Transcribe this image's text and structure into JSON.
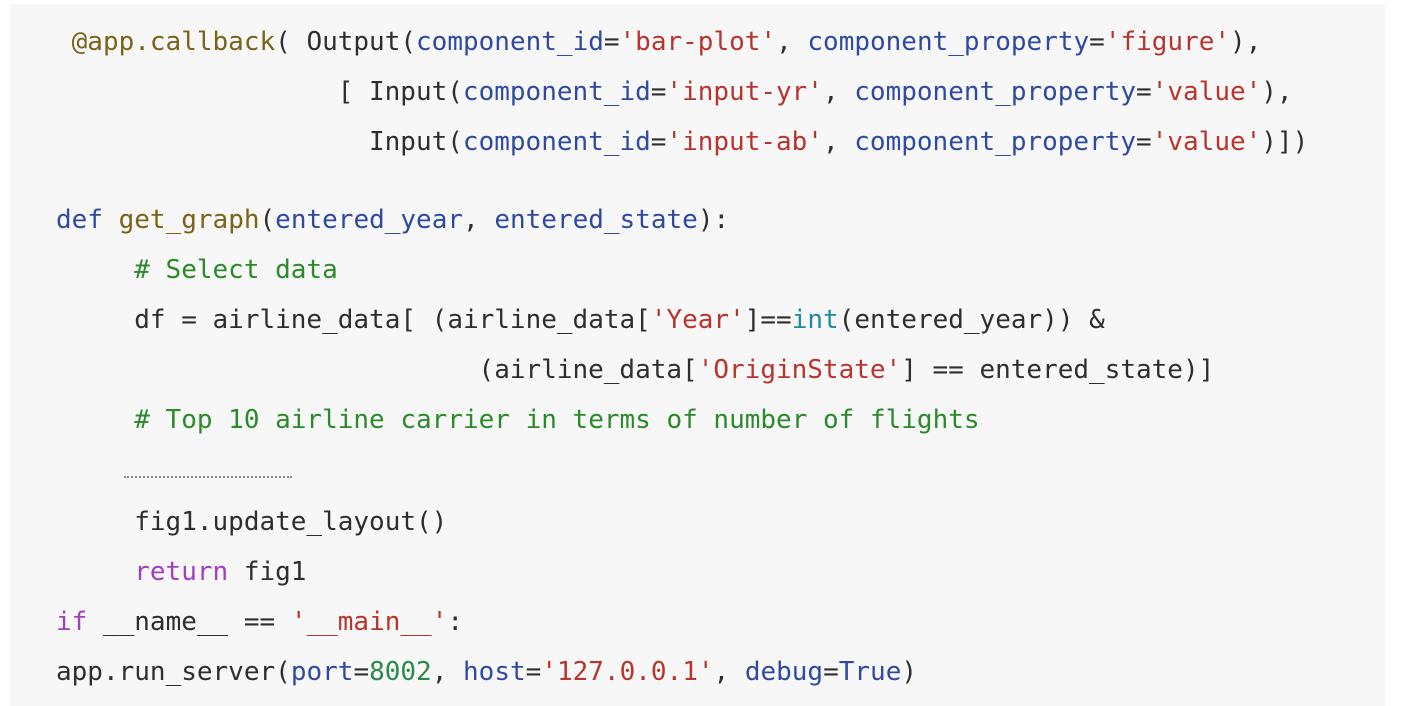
{
  "theme": {
    "default": "#2e2e2e",
    "function": "#7a6417",
    "keyword": "#2f4aa0",
    "control": "#a23fc0",
    "string": "#b8352e",
    "comment": "#2b8a2b",
    "builtin": "#1f8aa6",
    "number": "#2b8a4a",
    "ellipsis": "#8a8a8a"
  },
  "code": {
    "lines": [
      {
        "indent": 1,
        "tokens": [
          {
            "t": "@app.callback",
            "c": "function"
          },
          {
            "t": "( Output(",
            "c": "default"
          },
          {
            "t": "component_id",
            "c": "keyword"
          },
          {
            "t": "=",
            "c": "default"
          },
          {
            "t": "'bar-plot'",
            "c": "string"
          },
          {
            "t": ", ",
            "c": "default"
          },
          {
            "t": "component_property",
            "c": "keyword"
          },
          {
            "t": "=",
            "c": "default"
          },
          {
            "t": "'figure'",
            "c": "string"
          },
          {
            "t": "),",
            "c": "default"
          }
        ]
      },
      {
        "indent": 18,
        "tokens": [
          {
            "t": "[ Input(",
            "c": "default"
          },
          {
            "t": "component_id",
            "c": "keyword"
          },
          {
            "t": "=",
            "c": "default"
          },
          {
            "t": "'input-yr'",
            "c": "string"
          },
          {
            "t": ", ",
            "c": "default"
          },
          {
            "t": "component_property",
            "c": "keyword"
          },
          {
            "t": "=",
            "c": "default"
          },
          {
            "t": "'value'",
            "c": "string"
          },
          {
            "t": "),",
            "c": "default"
          }
        ]
      },
      {
        "indent": 20,
        "tokens": [
          {
            "t": "Input(",
            "c": "default"
          },
          {
            "t": "component_id",
            "c": "keyword"
          },
          {
            "t": "=",
            "c": "default"
          },
          {
            "t": "'input-ab'",
            "c": "string"
          },
          {
            "t": ", ",
            "c": "default"
          },
          {
            "t": "component_property",
            "c": "keyword"
          },
          {
            "t": "=",
            "c": "default"
          },
          {
            "t": "'value'",
            "c": "string"
          },
          {
            "t": ")])",
            "c": "default"
          }
        ]
      },
      {
        "indent": 0,
        "tokens": [
          {
            "t": "def",
            "c": "keyword"
          },
          {
            "t": " ",
            "c": "default"
          },
          {
            "t": "get_graph",
            "c": "function"
          },
          {
            "t": "(",
            "c": "default"
          },
          {
            "t": "entered_year",
            "c": "keyword"
          },
          {
            "t": ", ",
            "c": "default"
          },
          {
            "t": "entered_state",
            "c": "keyword"
          },
          {
            "t": "):",
            "c": "default"
          }
        ]
      },
      {
        "indent": 5,
        "tokens": [
          {
            "t": "# Select data",
            "c": "comment"
          }
        ]
      },
      {
        "indent": 5,
        "tokens": [
          {
            "t": "df = airline_data[ (airline_data[",
            "c": "default"
          },
          {
            "t": "'Year'",
            "c": "string"
          },
          {
            "t": "]==",
            "c": "default"
          },
          {
            "t": "int",
            "c": "builtin"
          },
          {
            "t": "(entered_year)) &",
            "c": "default"
          }
        ]
      },
      {
        "indent": 27,
        "tokens": [
          {
            "t": "(airline_data[",
            "c": "default"
          },
          {
            "t": "'OriginState'",
            "c": "string"
          },
          {
            "t": "] == entered_state)]",
            "c": "default"
          }
        ]
      },
      {
        "indent": 5,
        "tokens": [
          {
            "t": "# Top 10 airline carrier in terms of number of flights",
            "c": "comment"
          }
        ]
      },
      {
        "indent": 5,
        "tokens": [
          {
            "t": "fig1.update_layout()",
            "c": "default"
          }
        ]
      },
      {
        "indent": 5,
        "tokens": [
          {
            "t": "return",
            "c": "control"
          },
          {
            "t": " fig1",
            "c": "default"
          }
        ]
      },
      {
        "indent": 0,
        "tokens": [
          {
            "t": "if",
            "c": "control"
          },
          {
            "t": " __name__ == ",
            "c": "default"
          },
          {
            "t": "'__main__'",
            "c": "string"
          },
          {
            "t": ":",
            "c": "default"
          }
        ]
      },
      {
        "indent": 0,
        "tokens": [
          {
            "t": "app.run_server(",
            "c": "default"
          },
          {
            "t": "port",
            "c": "keyword"
          },
          {
            "t": "=",
            "c": "default"
          },
          {
            "t": "8002",
            "c": "number"
          },
          {
            "t": ", ",
            "c": "default"
          },
          {
            "t": "host",
            "c": "keyword"
          },
          {
            "t": "=",
            "c": "default"
          },
          {
            "t": "'127.0.0.1'",
            "c": "string"
          },
          {
            "t": ", ",
            "c": "default"
          },
          {
            "t": "debug",
            "c": "keyword"
          },
          {
            "t": "=",
            "c": "default"
          },
          {
            "t": "True",
            "c": "keyword"
          },
          {
            "t": ")",
            "c": "default"
          }
        ]
      }
    ]
  }
}
